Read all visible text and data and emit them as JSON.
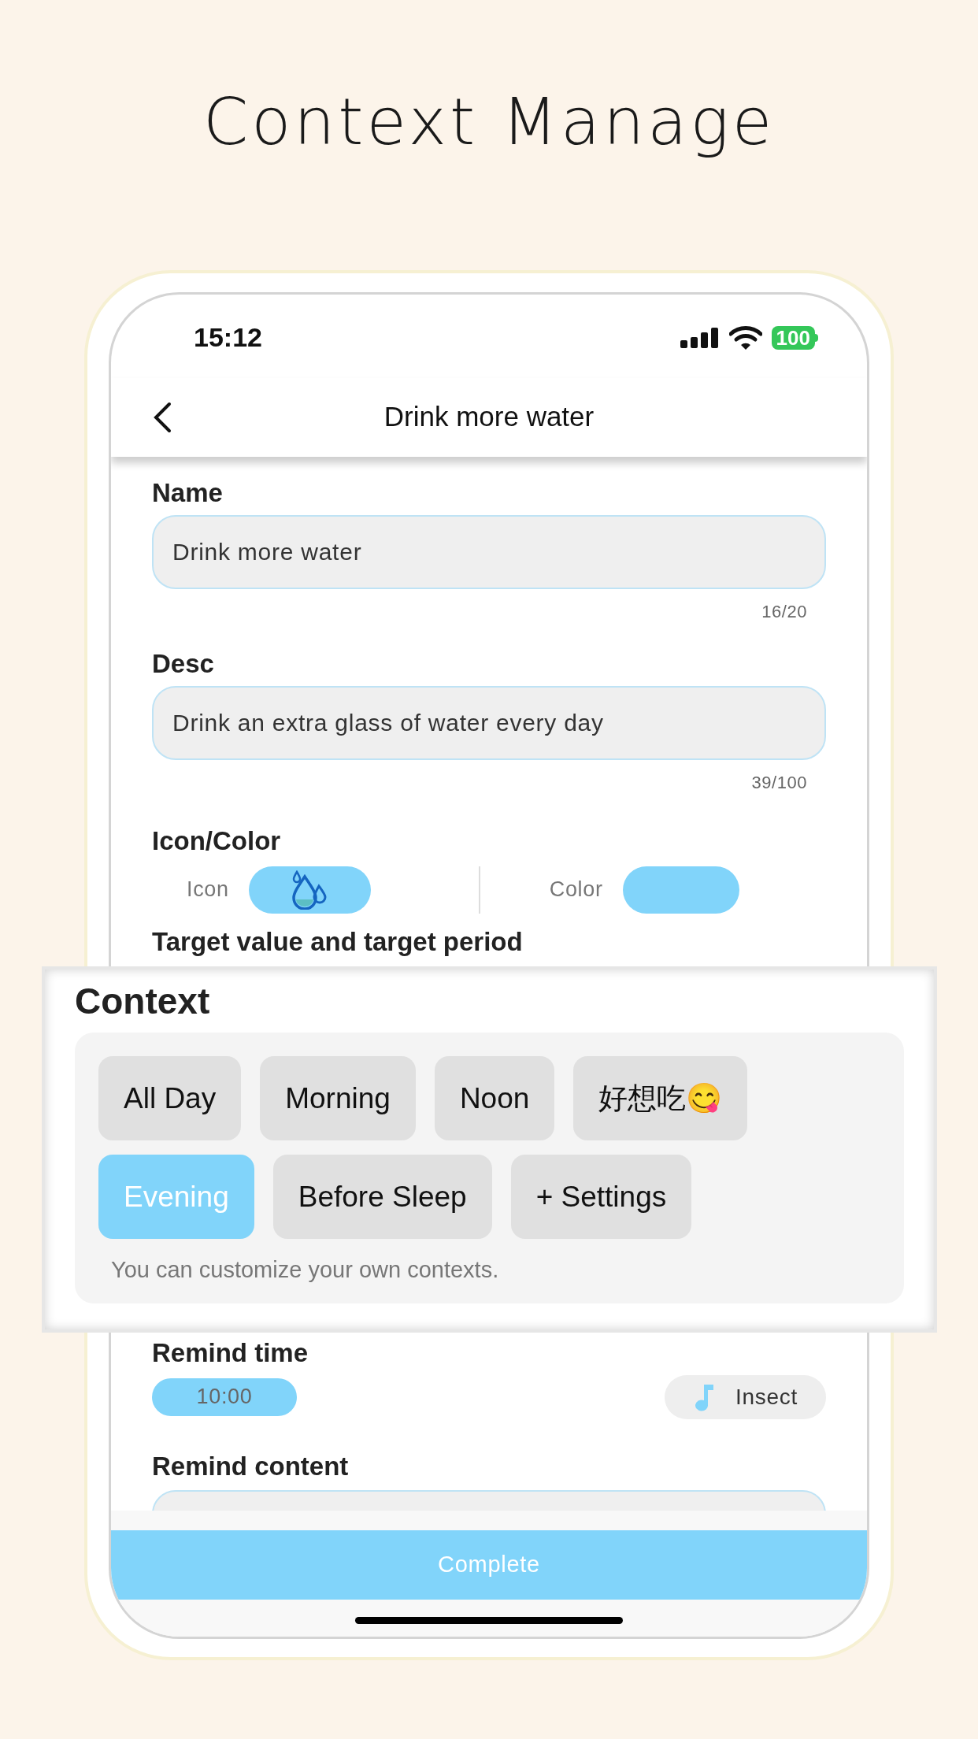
{
  "headline": "Context Manage",
  "status_bar": {
    "time": "15:12",
    "battery": "100"
  },
  "nav": {
    "title": "Drink more water"
  },
  "name_field": {
    "label": "Name",
    "value": "Drink more water",
    "counter": "16/20"
  },
  "desc_field": {
    "label": "Desc",
    "value": "Drink an extra glass of water every day",
    "counter": "39/100"
  },
  "icon_color": {
    "label": "Icon/Color",
    "icon_label": "Icon",
    "color_label": "Color",
    "color": "#81d4fa"
  },
  "target_heading": "Target value and target period",
  "context": {
    "title": "Context",
    "chips": [
      {
        "label": "All Day",
        "selected": false
      },
      {
        "label": "Morning",
        "selected": false
      },
      {
        "label": "Noon",
        "selected": false
      },
      {
        "label": "好想吃😋",
        "selected": false
      },
      {
        "label": "Evening",
        "selected": true
      },
      {
        "label": "Before Sleep",
        "selected": false
      },
      {
        "label": "+ Settings",
        "selected": false
      }
    ],
    "hint": "You can customize your own contexts."
  },
  "remind_time": {
    "label": "Remind time",
    "time": "10:00",
    "sound": "Insect"
  },
  "remind_content": {
    "label": "Remind content"
  },
  "complete_button": "Complete"
}
